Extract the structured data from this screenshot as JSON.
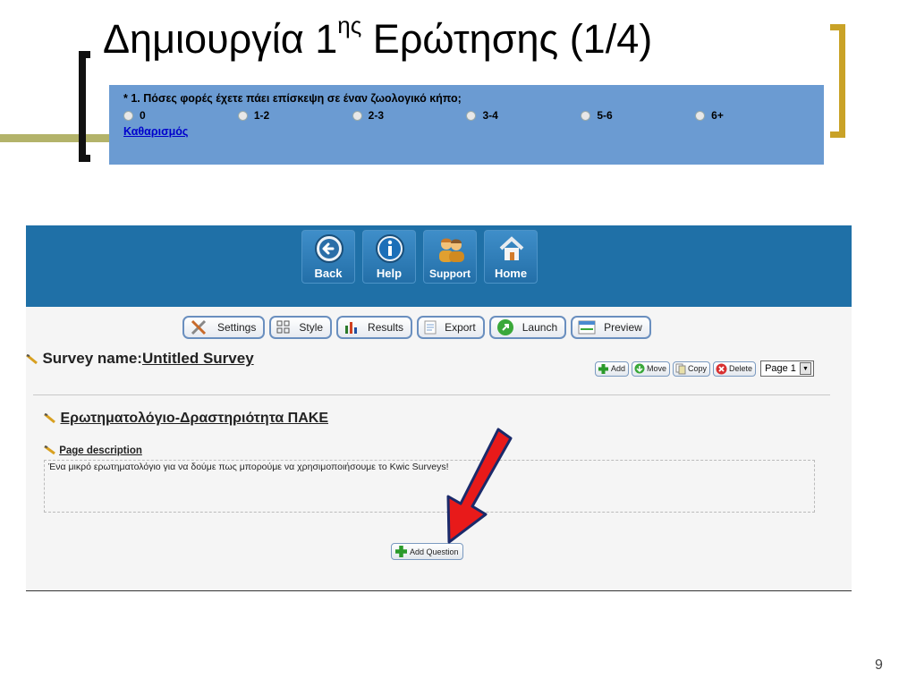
{
  "slide": {
    "title_main": "Δημιουργία 1",
    "title_sup": "ης",
    "title_rest": " Ερώτησης (1/4)",
    "page_number": "9"
  },
  "question_preview": {
    "question": "* 1. Πόσες φορές έχετε πάει επίσκεψη σε έναν ζωολογικό κήπο;",
    "options": [
      "0",
      "1-2",
      "2-3",
      "3-4",
      "5-6",
      "6+"
    ],
    "clear_label": "Καθαρισμός",
    "background": "#6b9bd2"
  },
  "app": {
    "header_color": "#1f70a7",
    "nav": [
      {
        "label": "Back",
        "icon": "back-arrow-icon"
      },
      {
        "label": "Help",
        "icon": "info-icon"
      },
      {
        "label": "Support",
        "icon": "people-icon"
      },
      {
        "label": "Home",
        "icon": "home-icon"
      }
    ],
    "toolbar": [
      {
        "label": "Settings",
        "icon": "tools-icon"
      },
      {
        "label": "Style",
        "icon": "grid-icon"
      },
      {
        "label": "Results",
        "icon": "bar-chart-icon"
      },
      {
        "label": "Export",
        "icon": "document-icon"
      },
      {
        "label": "Launch",
        "icon": "launch-icon"
      },
      {
        "label": "Preview",
        "icon": "preview-icon"
      }
    ],
    "survey_name_label": "Survey name:",
    "survey_name_value": "Untitled Survey",
    "page_tools": [
      {
        "label": "Add",
        "icon": "plus-icon"
      },
      {
        "label": "Move",
        "icon": "move-icon"
      },
      {
        "label": "Copy",
        "icon": "copy-icon"
      },
      {
        "label": "Delete",
        "icon": "delete-icon"
      }
    ],
    "page_select_value": "Page 1",
    "questionnaire_title": "Ερωτηματολόγιο-Δραστηριότητα ΠΑΚΕ",
    "page_description_label": "Page description",
    "page_description_text": "Ένα μικρό ερωτηματολόγιο για να δούμε πως μπορούμε να χρησιμοποιήσουμε το Kwic Surveys!",
    "add_question_label": "Add Question"
  }
}
